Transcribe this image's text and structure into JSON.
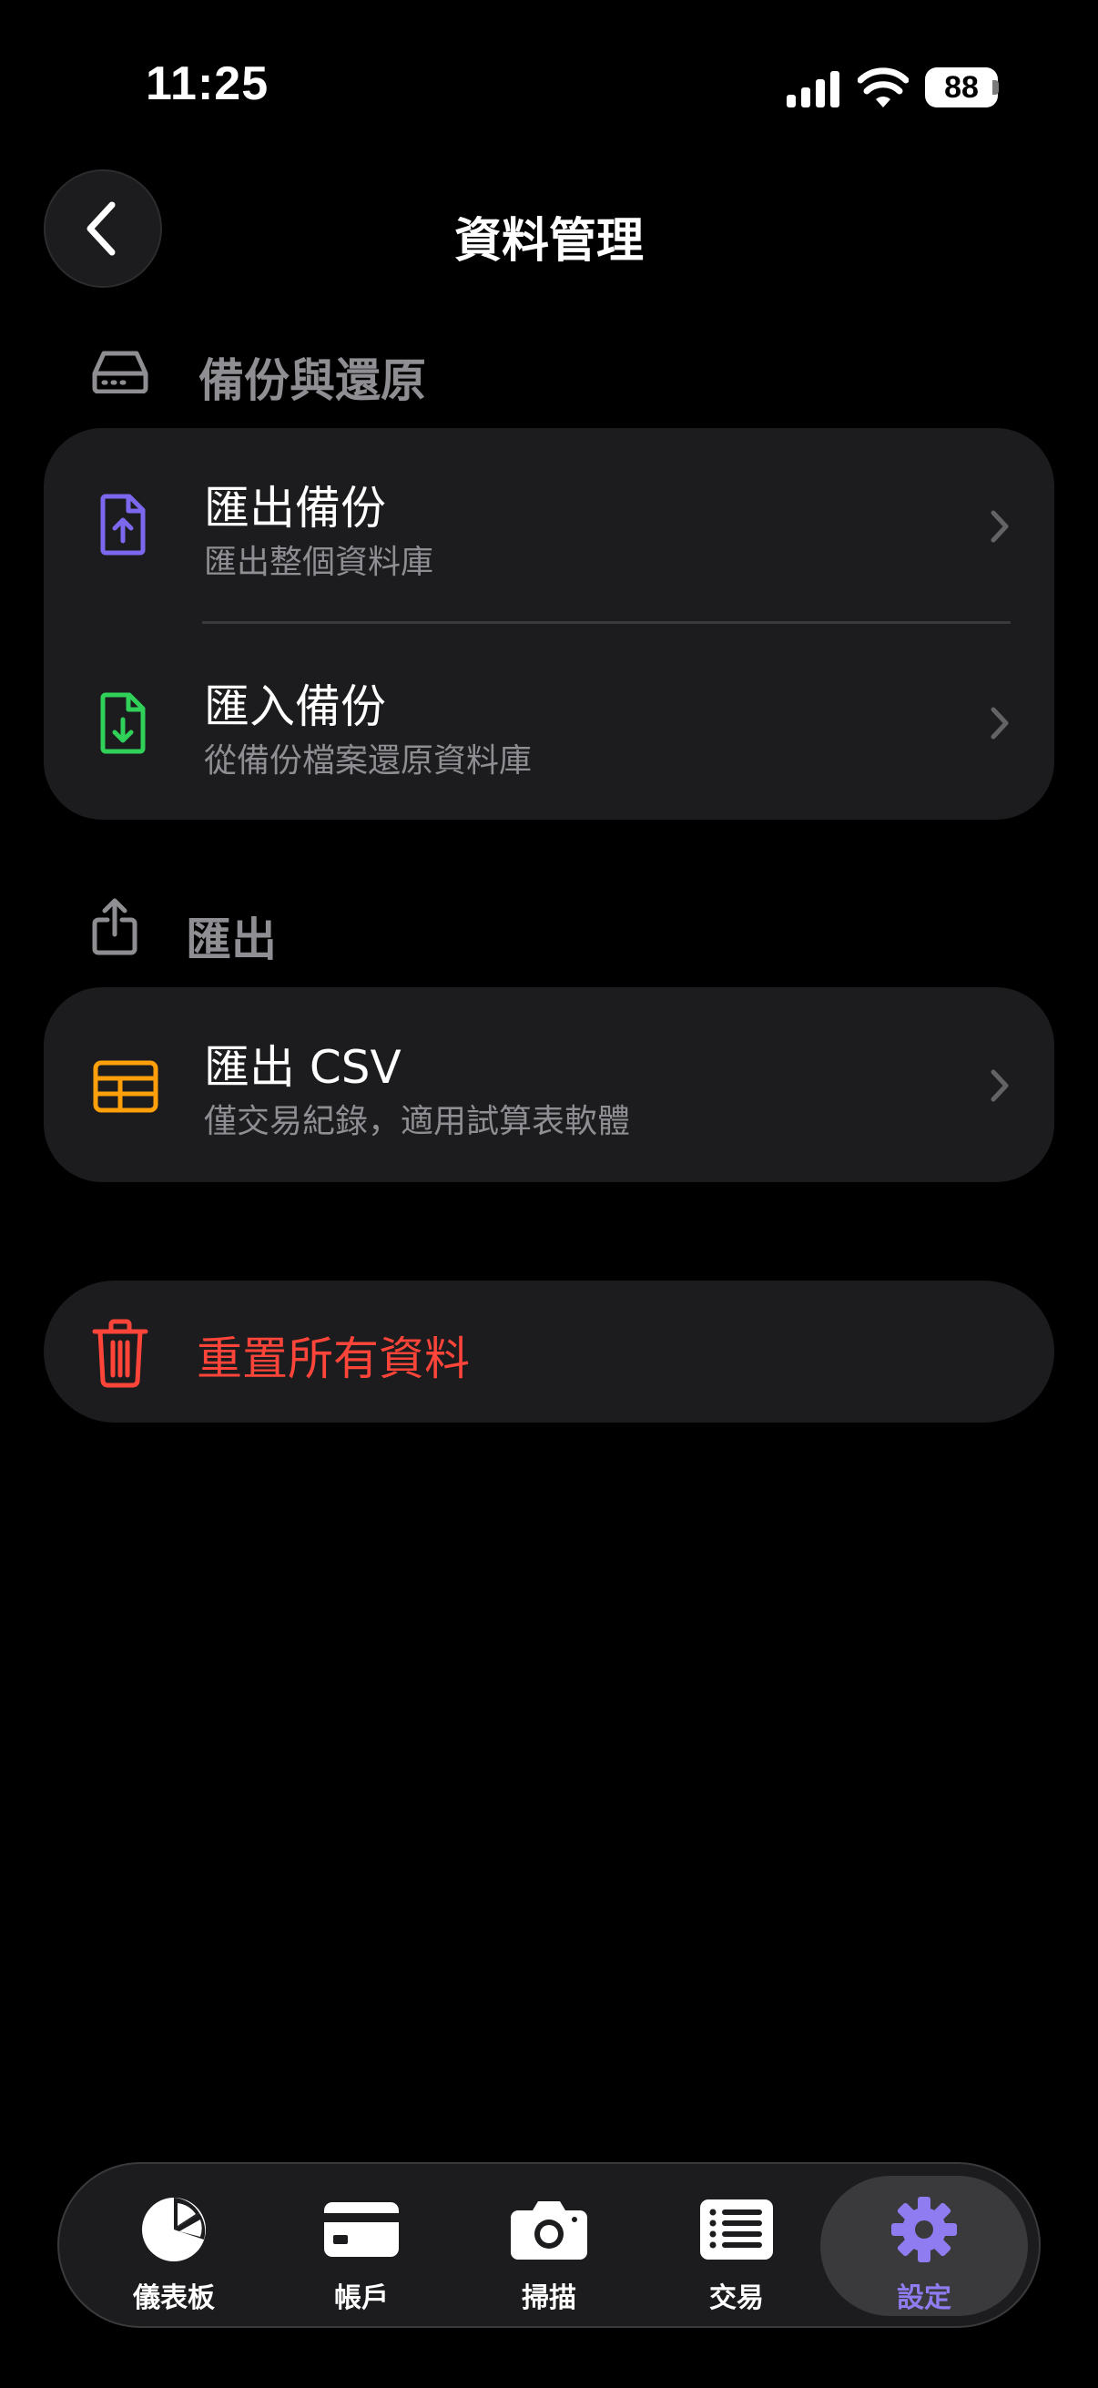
{
  "status_bar": {
    "time": "11:25",
    "battery": "88"
  },
  "header": {
    "title": "資料管理",
    "back_icon": "chevron-left-icon"
  },
  "backup_section": {
    "title": "備份與還原",
    "icon": "hard-drive-icon",
    "rows": [
      {
        "title": "匯出備份",
        "subtitle": "匯出整個資料庫",
        "icon": "file-upload-icon",
        "icon_color": "#7b68ee"
      },
      {
        "title": "匯入備份",
        "subtitle": "從備份檔案還原資料庫",
        "icon": "file-download-icon",
        "icon_color": "#30d158"
      }
    ]
  },
  "export_section": {
    "title": "匯出",
    "icon": "share-icon",
    "rows": [
      {
        "title": "匯出 CSV",
        "subtitle": "僅交易紀錄，適用試算表軟體",
        "icon": "table-icon",
        "icon_color": "#ff9f0a"
      }
    ]
  },
  "reset": {
    "label": "重置所有資料",
    "icon": "trash-icon",
    "color": "#ff453a"
  },
  "tabbar": {
    "tabs": [
      {
        "label": "儀表板",
        "icon": "pie-chart-icon"
      },
      {
        "label": "帳戶",
        "icon": "credit-card-icon"
      },
      {
        "label": "掃描",
        "icon": "camera-icon"
      },
      {
        "label": "交易",
        "icon": "list-icon"
      },
      {
        "label": "設定",
        "icon": "gear-icon",
        "active": true
      }
    ],
    "active_color": "#8e7cf0"
  }
}
